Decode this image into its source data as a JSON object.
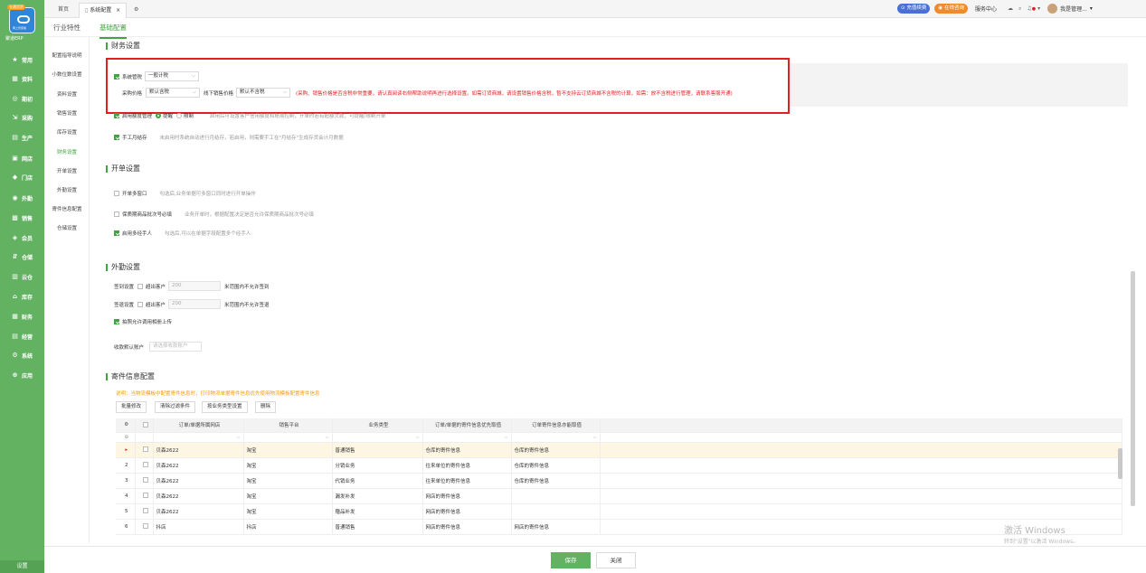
{
  "sidebar": {
    "badge": "仓建货贸",
    "logo_sub": "网上管家婆",
    "app_name": "聚道ERP",
    "items": [
      {
        "icon": "★",
        "label": "常用"
      },
      {
        "icon": "▦",
        "label": "资料"
      },
      {
        "icon": "◎",
        "label": "期初"
      },
      {
        "icon": "⇲",
        "label": "采购"
      },
      {
        "icon": "▤",
        "label": "生产"
      },
      {
        "icon": "▣",
        "label": "网店"
      },
      {
        "icon": "◆",
        "label": "门店"
      },
      {
        "icon": "◉",
        "label": "外勤"
      },
      {
        "icon": "▩",
        "label": "销售"
      },
      {
        "icon": "◈",
        "label": "会员"
      },
      {
        "icon": "⇵",
        "label": "仓储"
      },
      {
        "icon": "▥",
        "label": "云仓"
      },
      {
        "icon": "⌂",
        "label": "库存"
      },
      {
        "icon": "▦",
        "label": "财务"
      },
      {
        "icon": "▤",
        "label": "经营"
      },
      {
        "icon": "⚙",
        "label": "系统"
      },
      {
        "icon": "⊕",
        "label": "应用"
      }
    ],
    "setting": "设置"
  },
  "topbar": {
    "tabs": [
      "首页",
      "系统配置"
    ],
    "recharge": "充值续费",
    "consult": "在线咨询",
    "service": "服务中心",
    "user": "我是管理..."
  },
  "subnav": {
    "tabs": [
      "行业特性",
      "基础配置"
    ]
  },
  "leftmenu": [
    "配置指导说明",
    "小数位数设置",
    "资料设置",
    "销售设置",
    "库存设置",
    "财务设置",
    "开单设置",
    "外勤设置",
    "寄件信息配置",
    "仓储设置"
  ],
  "finance": {
    "title": "财务设置",
    "sys_tax_label": "系统管税",
    "sys_tax_value": "一般计税",
    "purchase_price_label": "采购价格",
    "purchase_price_value": "默认含税",
    "offline_price_label": "线下销售价格",
    "offline_price_value": "默认不含税",
    "note": "(采购、销售价格是否含税非常重要，请认真阅读右侧帮助说明再进行选择设置。如需订货商城，请设置销售价格含税，暂不支持云订货商城不含税的计算，如需：放不含税进行管理，请联系客服开通)",
    "credit_label": "启用额度管理",
    "credit_opt1": "提醒",
    "credit_opt2": "限制",
    "credit_desc": "启用后可设置客户信用额度和账期控制，开单时若有超额欠款，可提醒/限制开单",
    "manual_label": "手工月结存",
    "manual_desc": "未启用时系统自动进行月结存，若启用，则需要手工在\"月结存\"生成存货会计月数据"
  },
  "order": {
    "title": "开单设置",
    "multi_window_label": "开单多窗口",
    "multi_window_desc": "勾选后,业务单据可多窗口同时进行开单操作",
    "batch_label": "保质期商品批次号必填",
    "batch_desc": "业务开单时，根据配置决定是否允许保质期商品批次号必填",
    "multi_handler_label": "启用多经手人",
    "multi_handler_desc": "勾选后,可以在单据字段配置多个经手人"
  },
  "field": {
    "title": "外勤设置",
    "checkin_label": "签到设置",
    "checkout_label": "签退设置",
    "beyond_label": "超出客户",
    "checkin_value": "200",
    "checkout_value": "200",
    "checkin_unit": "米范围内不允许签到",
    "checkout_unit": "米范围内不允许签退",
    "photo_label": "拍照允许调用相册上传",
    "account_label": "收款默认账户",
    "account_placeholder": "请选择收款账户"
  },
  "shipping": {
    "title": "寄件信息配置",
    "note": "说明：当物流模板中配置寄件信息时，打印物流单据寄件信息优先使用物流模板配置寄件信息",
    "buttons": [
      "批量修改",
      "清除过滤条件",
      "按业务类型设置",
      "删除"
    ],
    "columns": [
      "订单/单据所属网店",
      "销售平台",
      "业务类型",
      "订单/单据的寄件信息优先取值",
      "订单寄件信息亦能取值"
    ],
    "rows": [
      {
        "no": "1",
        "store": "贝森2622",
        "platform": "淘宝",
        "type": "普通销售",
        "pri": "仓库的寄件信息",
        "alt": "仓库的寄件信息"
      },
      {
        "no": "2",
        "store": "贝森2622",
        "platform": "淘宝",
        "type": "分销业务",
        "pri": "往来单位的寄件信息",
        "alt": "仓库的寄件信息"
      },
      {
        "no": "3",
        "store": "贝森2622",
        "platform": "淘宝",
        "type": "代销业务",
        "pri": "往来单位的寄件信息",
        "alt": "仓库的寄件信息"
      },
      {
        "no": "4",
        "store": "贝森2622",
        "platform": "淘宝",
        "type": "漏发补发",
        "pri": "网店的寄件信息",
        "alt": ""
      },
      {
        "no": "5",
        "store": "贝森2622",
        "platform": "淘宝",
        "type": "赠品补发",
        "pri": "网店的寄件信息",
        "alt": ""
      },
      {
        "no": "6",
        "store": "抖店",
        "platform": "抖店",
        "type": "普通销售",
        "pri": "网店的寄件信息",
        "alt": "网店的寄件信息"
      }
    ]
  },
  "footer": {
    "save": "保存",
    "close": "关闭"
  },
  "watermark": {
    "title": "激活 Windows",
    "sub": "转到\"设置\"以激活 Windows。"
  }
}
